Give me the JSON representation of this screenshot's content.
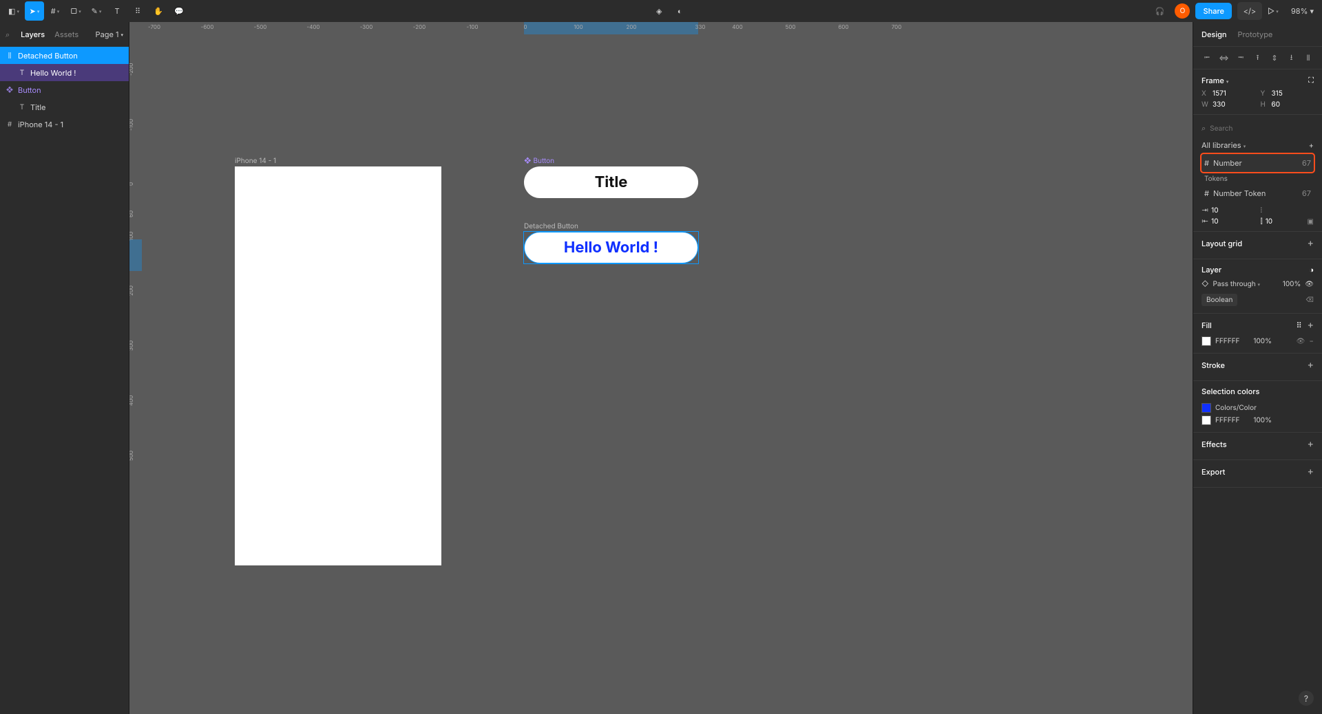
{
  "toolbar": {
    "share_label": "Share",
    "zoom": "98%",
    "avatar_initial": "O"
  },
  "left": {
    "tab_layers": "Layers",
    "tab_assets": "Assets",
    "page_label": "Page 1",
    "layers": [
      {
        "name": "Detached Button",
        "type": "frame",
        "selected": "sel"
      },
      {
        "name": "Hello World !",
        "type": "text",
        "depth": 1,
        "selected": "sel-soft"
      },
      {
        "name": "Button",
        "type": "component",
        "comp": true
      },
      {
        "name": "Title",
        "type": "text",
        "depth": 1
      },
      {
        "name": "iPhone 14 - 1",
        "type": "frame"
      }
    ]
  },
  "canvas": {
    "ruler_h": [
      "-700",
      "-600",
      "-500",
      "-400",
      "-300",
      "-200",
      "-100",
      "0",
      "100",
      "200",
      "330",
      "400",
      "500",
      "600",
      "700"
    ],
    "ruler_v": [
      "-200",
      "-100",
      "0",
      "60",
      "100",
      "200",
      "300",
      "400",
      "500"
    ],
    "iphone_label": "iPhone 14 - 1",
    "button_label": "Button",
    "detached_label": "Detached Button",
    "title_text": "Title",
    "hello_text": "Hello World !"
  },
  "right": {
    "tab_design": "Design",
    "tab_prototype": "Prototype",
    "frame_label": "Frame",
    "x_lbl": "X",
    "x_val": "1571",
    "y_lbl": "Y",
    "y_val": "315",
    "w_lbl": "W",
    "w_val": "330",
    "h_lbl": "H",
    "h_val": "60",
    "search_placeholder": "Search",
    "all_libraries": "All libraries",
    "lib_number": "Number",
    "lib_number_cnt": "67",
    "tokens_label": "Tokens",
    "lib_number_token": "Number Token",
    "lib_number_token_cnt": "67",
    "gap_a": "10",
    "gap_b": "10",
    "gap_c": "10",
    "layout_grid": "Layout grid",
    "layer_section": "Layer",
    "blend_mode": "Pass through",
    "opacity": "100%",
    "boolean_label": "Boolean",
    "fill_section": "Fill",
    "fill_hex": "FFFFFF",
    "fill_pct": "100%",
    "stroke_section": "Stroke",
    "selcolors_section": "Selection colors",
    "selcolor_name": "Colors/Color",
    "selcolor_hex": "FFFFFF",
    "selcolor_pct": "100%",
    "effects_section": "Effects",
    "export_section": "Export"
  }
}
